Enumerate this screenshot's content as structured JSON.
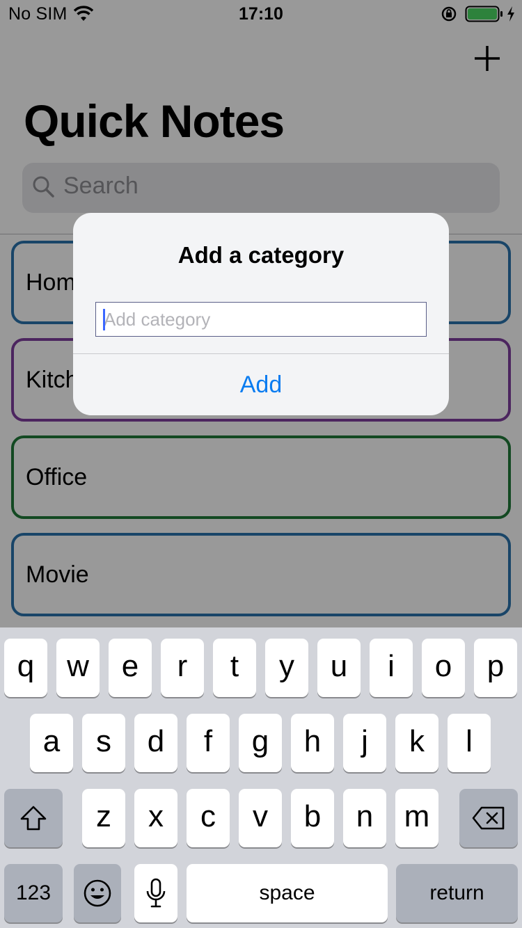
{
  "status_bar": {
    "carrier": "No SIM",
    "time": "17:10",
    "icons": [
      "wifi-icon",
      "lock-rotation-icon",
      "battery-icon",
      "charging-icon"
    ],
    "battery_color": "#4cd964"
  },
  "header": {
    "title": "Quick Notes",
    "add_icon": "plus-icon",
    "search_placeholder": "Search"
  },
  "categories": [
    {
      "label": "Home",
      "color": "#2a74ad"
    },
    {
      "label": "Kitchen",
      "color": "#7f3e9e"
    },
    {
      "label": "Office",
      "color": "#217a3a"
    },
    {
      "label": "Movie",
      "color": "#2a74ad"
    }
  ],
  "alert": {
    "title": "Add a category",
    "input_value": "",
    "input_placeholder": "Add category",
    "action_label": "Add",
    "action_color": "#0a7cf0"
  },
  "keyboard": {
    "row1": [
      "q",
      "w",
      "e",
      "r",
      "t",
      "y",
      "u",
      "i",
      "o",
      "p"
    ],
    "row2": [
      "a",
      "s",
      "d",
      "f",
      "g",
      "h",
      "j",
      "k",
      "l"
    ],
    "row3": [
      "z",
      "x",
      "c",
      "v",
      "b",
      "n",
      "m"
    ],
    "shift_icon": "shift-icon",
    "delete_icon": "delete-icon",
    "numbers_label": "123",
    "emoji_icon": "emoji-icon",
    "mic_icon": "microphone-icon",
    "space_label": "space",
    "return_label": "return"
  }
}
